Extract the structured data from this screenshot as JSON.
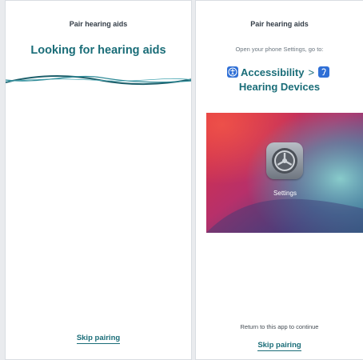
{
  "left_screen": {
    "header_title": "Pair hearing aids",
    "status_title": "Looking for hearing aids",
    "skip_label": "Skip pairing"
  },
  "right_screen": {
    "header_title": "Pair hearing aids",
    "instruction": "Open your phone Settings, go to:",
    "path_first": "Accessibility",
    "path_separator": ">",
    "path_second": "Hearing Devices",
    "settings_app_label": "Settings",
    "return_text": "Return to this app to continue",
    "skip_label": "Skip pairing"
  },
  "colors": {
    "accent_teal": "#1a6d78",
    "ios_icon_blue": "#2f6fd6"
  },
  "icons": [
    "wave-graphic",
    "accessibility-icon",
    "hearing-device-icon",
    "settings-gear-icon"
  ]
}
